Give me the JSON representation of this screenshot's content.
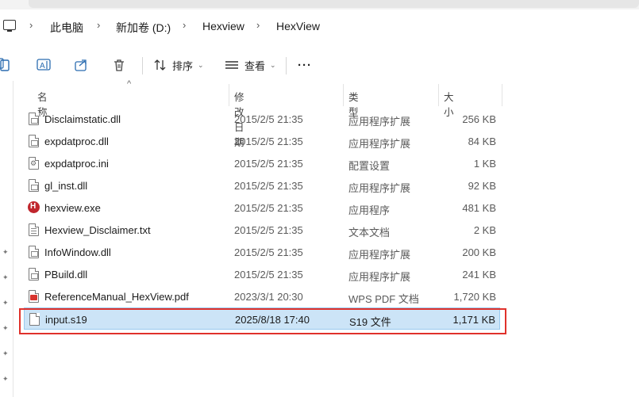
{
  "breadcrumb": [
    "此电脑",
    "新加卷 (D:)",
    "Hexview",
    "HexView"
  ],
  "toolbar": {
    "sort_label": "排序",
    "view_label": "查看",
    "more_label": "···"
  },
  "columns": {
    "name": "名称",
    "date": "修改日期",
    "type": "类型",
    "size": "大小"
  },
  "files": [
    {
      "name": "Disclaimstatic.dll",
      "date": "2015/2/5 21:35",
      "type": "应用程序扩展",
      "size": "256 KB",
      "icon": "dll-file-icon"
    },
    {
      "name": "expdatproc.dll",
      "date": "2015/2/5 21:35",
      "type": "应用程序扩展",
      "size": "84 KB",
      "icon": "dll-file-icon"
    },
    {
      "name": "expdatproc.ini",
      "date": "2015/2/5 21:35",
      "type": "配置设置",
      "size": "1 KB",
      "icon": "settings-file-icon"
    },
    {
      "name": "gl_inst.dll",
      "date": "2015/2/5 21:35",
      "type": "应用程序扩展",
      "size": "92 KB",
      "icon": "dll-file-icon"
    },
    {
      "name": "hexview.exe",
      "date": "2015/2/5 21:35",
      "type": "应用程序",
      "size": "481 KB",
      "icon": "hexview-app-icon"
    },
    {
      "name": "Hexview_Disclaimer.txt",
      "date": "2015/2/5 21:35",
      "type": "文本文档",
      "size": "2 KB",
      "icon": "text-file-icon"
    },
    {
      "name": "InfoWindow.dll",
      "date": "2015/2/5 21:35",
      "type": "应用程序扩展",
      "size": "200 KB",
      "icon": "dll-file-icon"
    },
    {
      "name": "PBuild.dll",
      "date": "2015/2/5 21:35",
      "type": "应用程序扩展",
      "size": "241 KB",
      "icon": "dll-file-icon"
    },
    {
      "name": "ReferenceManual_HexView.pdf",
      "date": "2023/3/1 20:30",
      "type": "WPS PDF 文档",
      "size": "1,720 KB",
      "icon": "pdf-file-icon"
    },
    {
      "name": "input.s19",
      "date": "2025/8/18 17:40",
      "type": "S19 文件",
      "size": "1,171 KB",
      "icon": "blank-file-icon"
    }
  ],
  "selected_index": 9,
  "colors": {
    "selection": "#cce4f7",
    "highlight_box": "#e0312b"
  }
}
